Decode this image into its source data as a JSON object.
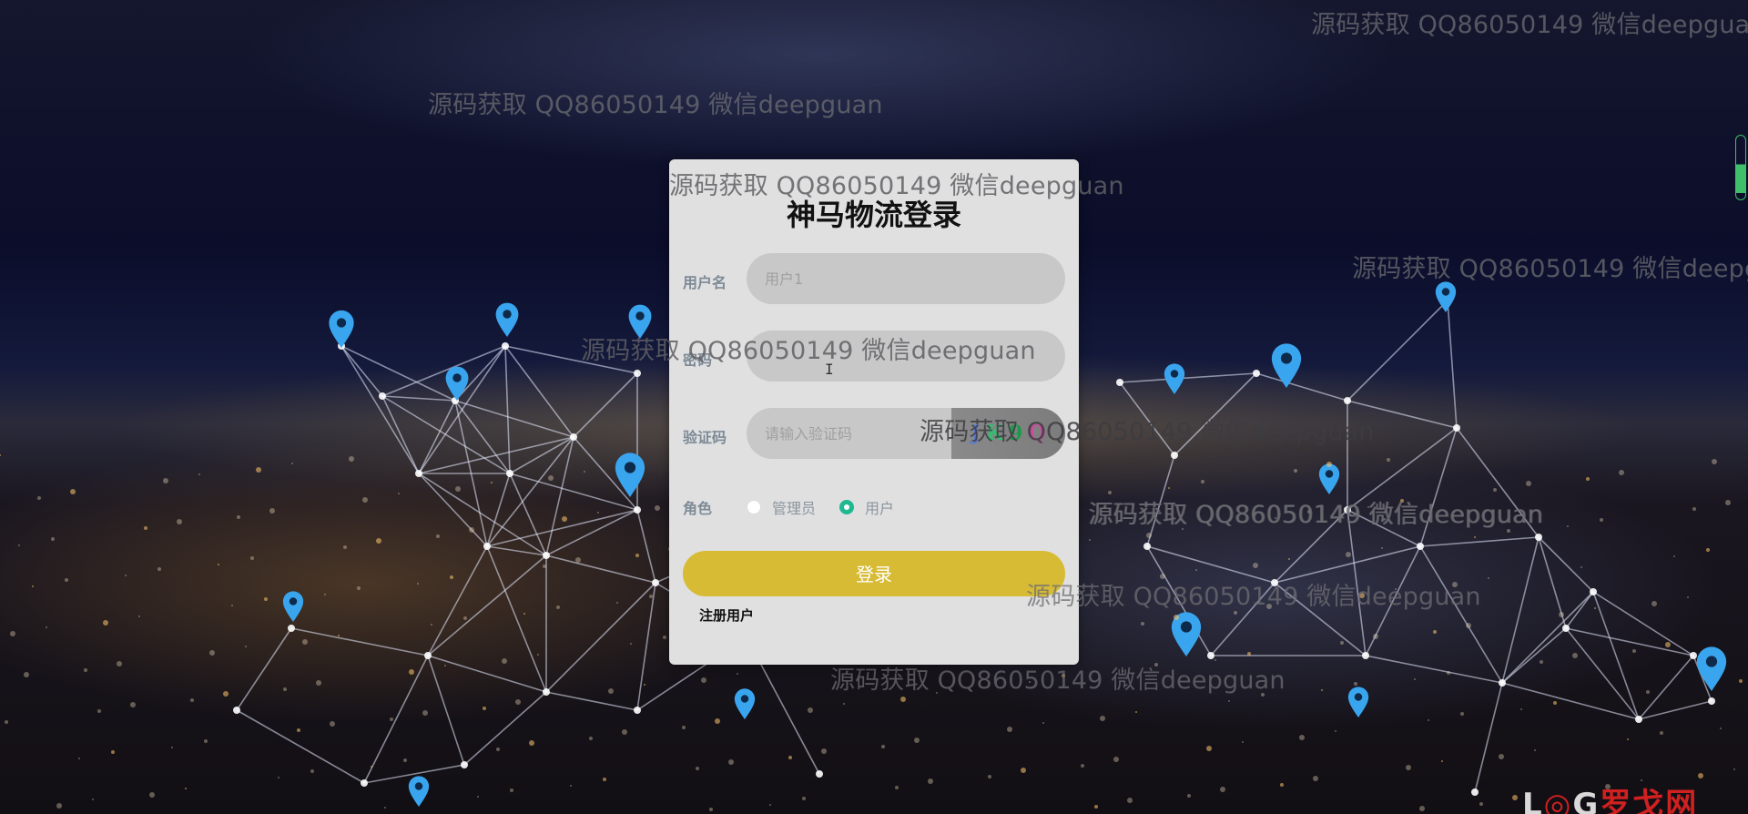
{
  "app": {
    "title": "神马物流登录"
  },
  "form": {
    "username": {
      "label": "用户名",
      "value": "",
      "placeholder": "用户1"
    },
    "password": {
      "label": "密码",
      "value": "",
      "placeholder": ""
    },
    "captcha": {
      "label": "验证码",
      "value": "",
      "placeholder": "请输入验证码",
      "image_chars": [
        "J",
        "K",
        "9",
        "Q"
      ],
      "image_colors": [
        "#5a78d8",
        "#30c070",
        "#1a9a4a",
        "#d04aa0"
      ]
    },
    "role": {
      "label": "角色",
      "options": [
        {
          "label": "管理员",
          "checked": false
        },
        {
          "label": "用户",
          "checked": true
        }
      ]
    },
    "login_button": "登录",
    "register_link": "注册用户"
  },
  "watermark": {
    "text": "源码获取 QQ86050149 微信deepguan"
  },
  "logo": {
    "text_prefix": "L",
    "text_mark": "◎",
    "text_suffix": "G",
    "cn": "罗戈网"
  },
  "colors": {
    "card_bg": "#e0e0e0",
    "input_bg": "#c8c8c8",
    "login_button": "#d7bb35",
    "radio_checked": "#1fb890",
    "label": "#7d8a96"
  }
}
